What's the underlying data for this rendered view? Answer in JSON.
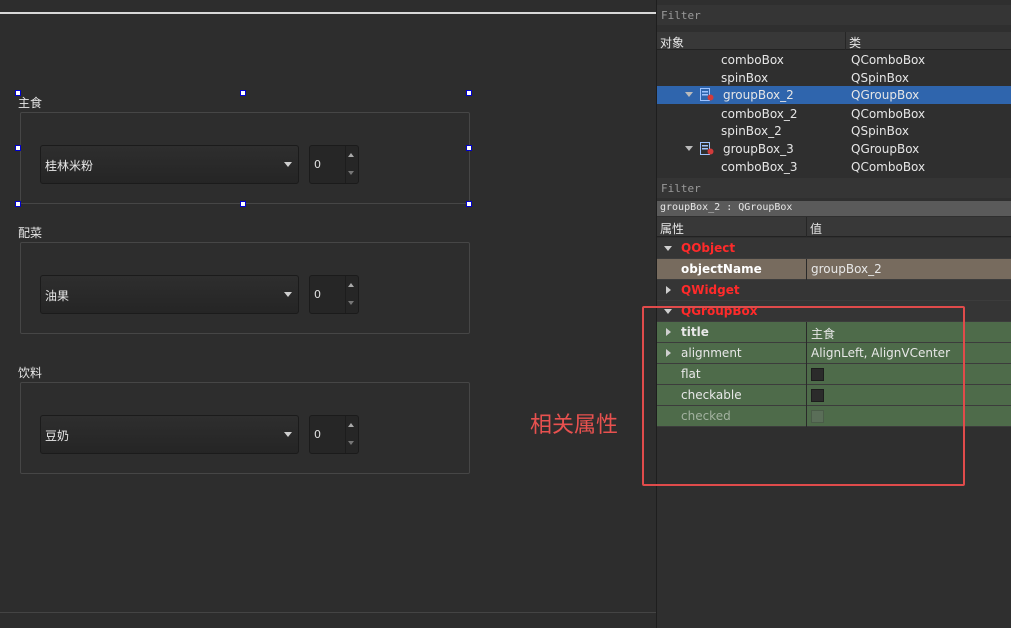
{
  "form": {
    "groups": [
      {
        "title": "主食",
        "combo_value": "桂林米粉",
        "spin_value": "0"
      },
      {
        "title": "配菜",
        "combo_value": "油果",
        "spin_value": "0"
      },
      {
        "title": "饮料",
        "combo_value": "豆奶",
        "spin_value": "0"
      }
    ],
    "annotation": "相关属性"
  },
  "object_inspector": {
    "filter_label": "Filter",
    "col_object": "对象",
    "col_class": "类",
    "rows": [
      {
        "name": "comboBox",
        "class": "QComboBox"
      },
      {
        "name": "spinBox",
        "class": "QSpinBox"
      },
      {
        "name": "groupBox_2",
        "class": "QGroupBox"
      },
      {
        "name": "comboBox_2",
        "class": "QComboBox"
      },
      {
        "name": "spinBox_2",
        "class": "QSpinBox"
      },
      {
        "name": "groupBox_3",
        "class": "QGroupBox"
      },
      {
        "name": "comboBox_3",
        "class": "QComboBox"
      }
    ]
  },
  "property_editor": {
    "filter_label": "Filter",
    "path": "groupBox_2 : QGroupBox",
    "col_property": "属性",
    "col_value": "值",
    "cat_qobject": "QObject",
    "objectName_label": "objectName",
    "objectName_value": "groupBox_2",
    "cat_qwidget": "QWidget",
    "cat_qgroupbox": "QGroupBox",
    "title_label": "title",
    "title_value": "主食",
    "alignment_label": "alignment",
    "alignment_value": "AlignLeft, AlignVCenter",
    "flat_label": "flat",
    "checkable_label": "checkable",
    "checked_label": "checked"
  }
}
